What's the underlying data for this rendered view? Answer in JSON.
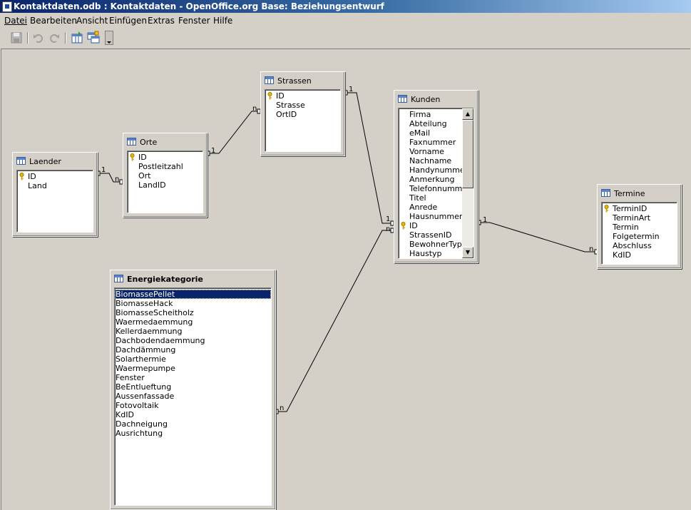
{
  "window": {
    "title": "Kontaktdaten.odb : Kontaktdaten - OpenOffice.org Base: Beziehungsentwurf"
  },
  "menu": [
    "Datei",
    "Bearbeiten",
    "Ansicht",
    "Einfügen",
    "Extras",
    "Fenster",
    "Hilfe"
  ],
  "toolbar": {
    "buttons": [
      "save-icon",
      "undo-icon",
      "redo-icon",
      "new-relation-icon",
      "add-tables-icon",
      "more-icon"
    ]
  },
  "tables": {
    "laender": {
      "name": "Laender",
      "fields": [
        {
          "name": "ID",
          "key": true
        },
        {
          "name": "Land",
          "key": false
        }
      ]
    },
    "orte": {
      "name": "Orte",
      "fields": [
        {
          "name": "ID",
          "key": true
        },
        {
          "name": "Postleitzahl",
          "key": false
        },
        {
          "name": "Ort",
          "key": false
        },
        {
          "name": "LandID",
          "key": false
        }
      ]
    },
    "strassen": {
      "name": "Strassen",
      "fields": [
        {
          "name": "ID",
          "key": true
        },
        {
          "name": "Strasse",
          "key": false
        },
        {
          "name": "OrtID",
          "key": false
        }
      ]
    },
    "kunden": {
      "name": "Kunden",
      "fields": [
        {
          "name": "Firma",
          "key": false
        },
        {
          "name": "Abteilung",
          "key": false
        },
        {
          "name": "eMail",
          "key": false
        },
        {
          "name": "Faxnummer",
          "key": false
        },
        {
          "name": "Vorname",
          "key": false
        },
        {
          "name": "Nachname",
          "key": false
        },
        {
          "name": "Handynummer",
          "key": false
        },
        {
          "name": "Anmerkung",
          "key": false
        },
        {
          "name": "Telefonnummer",
          "key": false
        },
        {
          "name": "Titel",
          "key": false
        },
        {
          "name": "Anrede",
          "key": false
        },
        {
          "name": "Hausnummer",
          "key": false
        },
        {
          "name": "ID",
          "key": true
        },
        {
          "name": "StrassenID",
          "key": false
        },
        {
          "name": "BewohnerTyp",
          "key": false
        },
        {
          "name": "Haustyp",
          "key": false
        }
      ]
    },
    "termine": {
      "name": "Termine",
      "fields": [
        {
          "name": "TerminID",
          "key": true
        },
        {
          "name": "TerminArt",
          "key": false
        },
        {
          "name": "Termin",
          "key": false
        },
        {
          "name": "Folgetermin",
          "key": false
        },
        {
          "name": "Abschluss",
          "key": false
        },
        {
          "name": "KdID",
          "key": false
        }
      ]
    },
    "energiekategorie": {
      "name": "Energiekategorie",
      "fields": [
        {
          "name": "BiomassePellet",
          "key": false,
          "selected": true
        },
        {
          "name": "BiomasseHack",
          "key": false
        },
        {
          "name": "BiomasseScheitholz",
          "key": false
        },
        {
          "name": "Waermedaemmung",
          "key": false
        },
        {
          "name": "Kellerdaemmung",
          "key": false
        },
        {
          "name": "Dachbodendaemmung",
          "key": false
        },
        {
          "name": "Dachdämmung",
          "key": false
        },
        {
          "name": "Solarthermie",
          "key": false
        },
        {
          "name": "Waermepumpe",
          "key": false
        },
        {
          "name": "Fenster",
          "key": false
        },
        {
          "name": "BeEntlueftung",
          "key": false
        },
        {
          "name": "Aussenfassade",
          "key": false
        },
        {
          "name": "Fotovoltaik",
          "key": false
        },
        {
          "name": "KdID",
          "key": false
        },
        {
          "name": "Dachneigung",
          "key": false
        },
        {
          "name": "Ausrichtung",
          "key": false
        }
      ]
    }
  },
  "relations": [
    {
      "from": "Laender",
      "to": "Orte",
      "from_card": "1",
      "to_card": "n"
    },
    {
      "from": "Orte",
      "to": "Strassen",
      "from_card": "1",
      "to_card": "n"
    },
    {
      "from": "Strassen",
      "to": "Kunden",
      "from_card": "1",
      "to_card": "n"
    },
    {
      "from": "Kunden",
      "to": "Energiekategorie",
      "from_card": "1",
      "to_card": "n"
    },
    {
      "from": "Kunden",
      "to": "Termine",
      "from_card": "1",
      "to_card": "n"
    }
  ],
  "colors": {
    "titlebar_start": "#0a246a",
    "background": "#d4d0c8",
    "selection": "#0a246a"
  }
}
